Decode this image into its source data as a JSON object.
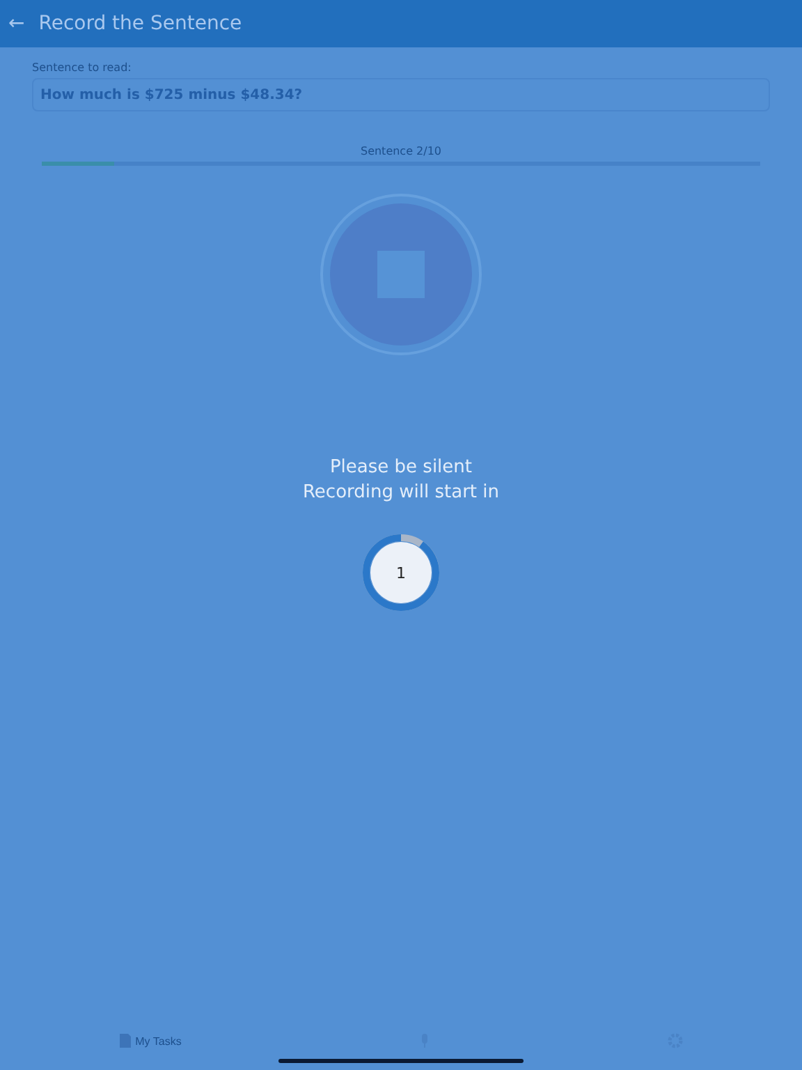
{
  "header": {
    "back_icon": "←",
    "title": "Record the Sentence"
  },
  "sentence": {
    "label": "Sentence to read:",
    "value": "How much is $725 minus $48.34?"
  },
  "progress": {
    "label": "Sentence 2/10",
    "level": 0.1
  },
  "countdown": {
    "line_1": "Please be silent",
    "line_2": "Recording will start in",
    "number": "1",
    "level": 0.9
  },
  "tab_bar": {
    "tabs": [
      {
        "kind": "tasks",
        "label": "My Tasks"
      },
      {
        "kind": "info"
      },
      {
        "kind": "settings"
      }
    ]
  }
}
